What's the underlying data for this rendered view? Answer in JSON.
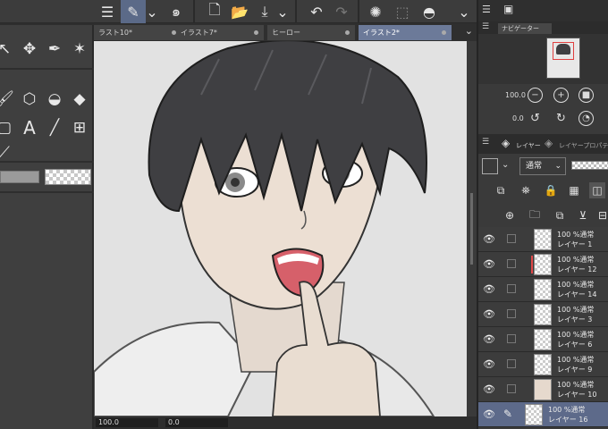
{
  "tabs": [
    {
      "label": "ラスト10*",
      "active": false
    },
    {
      "label": "イラスト7*",
      "active": false
    },
    {
      "label": "ヒーロー",
      "active": false
    },
    {
      "label": "イラスト2*",
      "active": true
    }
  ],
  "navigator": {
    "tab_label": "ナビゲーター",
    "zoom": "100.0",
    "angle": "0.0"
  },
  "layer_panel": {
    "tab_layer": "レイヤー",
    "tab_property": "レイヤープロパティ",
    "blend_mode": "通常"
  },
  "statusbar": {
    "zoom": "100.0",
    "angle": "0.0"
  },
  "layers": [
    {
      "mode": "100 %通常",
      "name": "レイヤー 1",
      "selected": false,
      "marker": false
    },
    {
      "mode": "100 %通常",
      "name": "レイヤー 12",
      "selected": false,
      "marker": true
    },
    {
      "mode": "100 %通常",
      "name": "レイヤー 14",
      "selected": false,
      "marker": false
    },
    {
      "mode": "100 %通常",
      "name": "レイヤー 3",
      "selected": false,
      "marker": false
    },
    {
      "mode": "100 %通常",
      "name": "レイヤー 6",
      "selected": false,
      "marker": false
    },
    {
      "mode": "100 %通常",
      "name": "レイヤー 9",
      "selected": false,
      "marker": false
    },
    {
      "mode": "100 %通常",
      "name": "レイヤー 10",
      "selected": false,
      "marker": false
    },
    {
      "mode": "100 %通常",
      "name": "レイヤー 16",
      "selected": true,
      "marker": false
    }
  ],
  "colors": {
    "accent": "#5d6a8a",
    "active_tab": "#6c7a99",
    "panel_bg": "#3a3a3a",
    "canvas_bg": "#e2e2e2"
  }
}
